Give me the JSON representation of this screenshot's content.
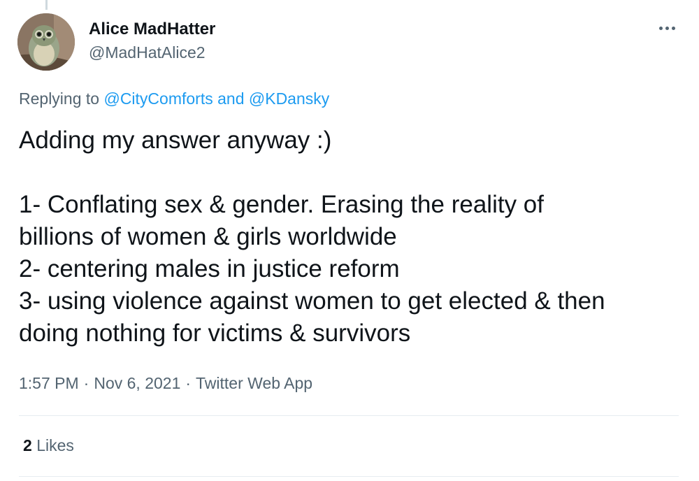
{
  "tweet": {
    "author": {
      "display_name": "Alice MadHatter",
      "handle": "@MadHatAlice2"
    },
    "replying": {
      "prefix": "Replying to",
      "user1": "@CityComforts",
      "conjunction": "and",
      "user2": "@KDansky"
    },
    "text_lines": [
      "Adding my answer anyway :)",
      "",
      "1- Conflating sex & gender. Erasing the reality of",
      "billions of women & girls worldwide",
      "2- centering males in justice reform",
      "3- using violence against women to get elected & then",
      "doing nothing for victims & survivors"
    ],
    "time": "1:57 PM",
    "date": "Nov 6, 2021",
    "separator": "·",
    "source": "Twitter Web App",
    "likes": {
      "count": "2",
      "label": "Likes"
    }
  },
  "icons": {
    "more": "more-horizontal-icon",
    "avatar": "bird-avatar"
  },
  "colors": {
    "link": "#1d9bf0",
    "secondary_text": "#536471",
    "primary_text": "#0f1419",
    "divider": "#e6ecf0"
  }
}
